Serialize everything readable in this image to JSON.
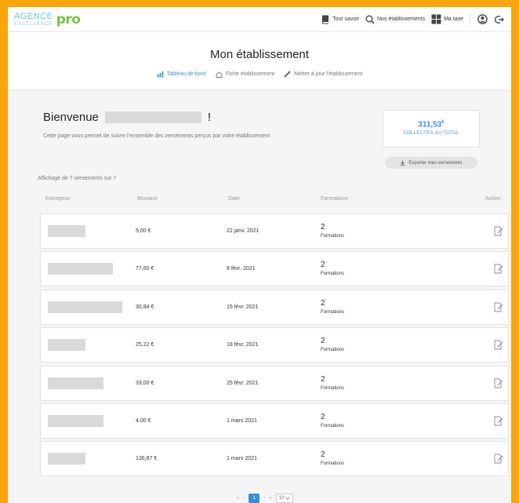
{
  "header": {
    "logo": {
      "agence": "AGENCE",
      "excellence": "EXCELLENCE",
      "pro": "pro"
    },
    "nav": [
      {
        "label": "Tout savoir",
        "icon": "book-icon"
      },
      {
        "label": "Nos établissements",
        "icon": "search-icon"
      },
      {
        "label": "Ma taxe",
        "icon": "grid-icon"
      }
    ],
    "icons": [
      "user-icon",
      "logout-icon"
    ]
  },
  "page": {
    "title": "Mon établissement",
    "subnav": [
      {
        "label": "Tableau de bord",
        "icon": "chart-icon",
        "active": true
      },
      {
        "label": "Fiche établissement",
        "icon": "home-icon",
        "active": false
      },
      {
        "label": "Mettre à jour l'établissement",
        "icon": "pencil-icon",
        "active": false
      }
    ]
  },
  "welcome": {
    "greeting": "Bienvenue",
    "exclamation": "!",
    "description": "Cette page vous permet de suivre l'ensemble des versements perçus par votre établissement"
  },
  "stats": {
    "value": "311,53",
    "currency": "€",
    "label": "COLLECTÉS AU TOTAL"
  },
  "export": {
    "label": "Exporter mes versements"
  },
  "table": {
    "display_count": "Affichage de 7 versements sur 7",
    "headers": {
      "company": "Entreprise",
      "amount": "Montant",
      "date": "Date",
      "formations": "Formations",
      "action": "Action"
    },
    "rows": [
      {
        "amount": "5,00 €",
        "date": "22 janv. 2021",
        "formations_count": "2",
        "formations_label": "Formations",
        "redacted_width": 48
      },
      {
        "amount": "77,60 €",
        "date": "8 févr. 2021",
        "formations_count": "2",
        "formations_label": "Formations",
        "redacted_width": 83
      },
      {
        "amount": "30,84 €",
        "date": "15 févr. 2021",
        "formations_count": "2",
        "formations_label": "Formations",
        "redacted_width": 95
      },
      {
        "amount": "25,22 €",
        "date": "18 févr. 2021",
        "formations_count": "2",
        "formations_label": "Formations",
        "redacted_width": 48
      },
      {
        "amount": "33,00 €",
        "date": "25 févr. 2021",
        "formations_count": "2",
        "formations_label": "Formations",
        "redacted_width": 71
      },
      {
        "amount": "4,00 €",
        "date": "1 mars 2021",
        "formations_count": "2",
        "formations_label": "Formations",
        "redacted_width": 71
      },
      {
        "amount": "136,87 €",
        "date": "1 mars 2021",
        "formations_count": "2",
        "formations_label": "Formations",
        "redacted_width": 48
      }
    ]
  },
  "pagination": {
    "first": "«",
    "prev": "‹",
    "current": "1",
    "next": "›",
    "last": "»",
    "page_size": "10"
  },
  "colors": {
    "accent": "#3b8fd9",
    "border_frame": "#f9a50d",
    "logo_pro": "#7ac043",
    "logo_agence": "#6ec1e4"
  }
}
